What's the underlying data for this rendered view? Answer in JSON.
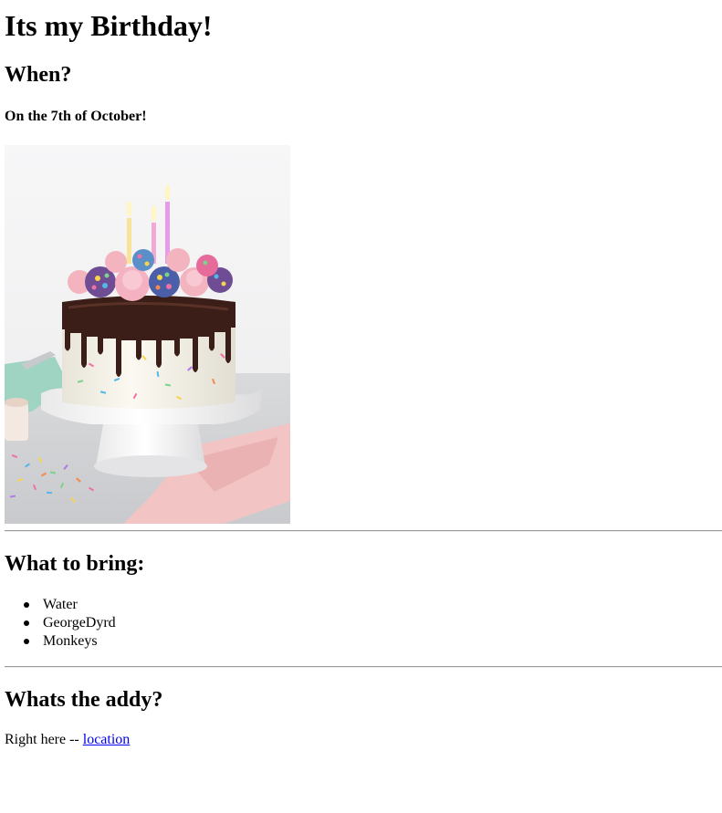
{
  "page": {
    "title": "Its my Birthday!"
  },
  "when": {
    "heading": "When?",
    "date": "On the 7th of October!"
  },
  "image": {
    "description_icon": "birthday-cake-image"
  },
  "bring": {
    "heading": "What to bring:",
    "items": [
      {
        "label": "Water"
      },
      {
        "label": "GeorgeDyrd"
      },
      {
        "label": "Monkeys"
      }
    ]
  },
  "addy": {
    "heading": "Whats the addy?",
    "prefix": "Right here -- ",
    "link_label": "location"
  },
  "colors": {
    "link": "#0000ee",
    "rule": "#9a9a9a",
    "background": "#ffffff"
  }
}
